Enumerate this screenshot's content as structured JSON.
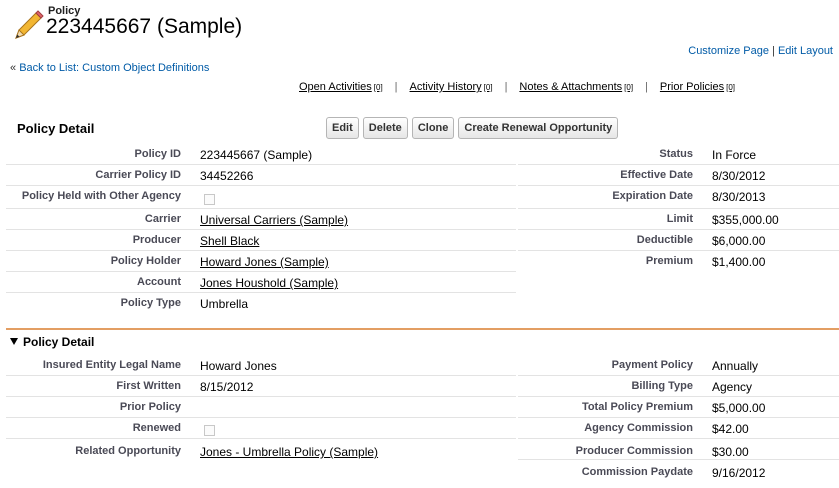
{
  "header": {
    "object_type": "Policy",
    "record_name": "223445667 (Sample)",
    "customize_page": "Customize Page",
    "link_separator": "|",
    "edit_layout": "Edit Layout",
    "back_prefix": "«",
    "back_link": "Back to List: Custom Object Definitions"
  },
  "related_links": [
    {
      "label": "Open Activities",
      "count": "[0]"
    },
    {
      "label": "Activity History",
      "count": "[0]"
    },
    {
      "label": "Notes & Attachments",
      "count": "[0]"
    },
    {
      "label": "Prior Policies",
      "count": "[0]"
    }
  ],
  "related_sep": "|",
  "detail": {
    "title": "Policy Detail",
    "buttons": {
      "edit": "Edit",
      "delete": "Delete",
      "clone": "Clone",
      "renewal": "Create Renewal Opportunity"
    },
    "left": [
      {
        "label": "Policy ID",
        "value": "223445667 (Sample)"
      },
      {
        "label": "Carrier Policy ID",
        "value": "34452266"
      },
      {
        "label": "Policy Held with Other Agency",
        "value": ""
      },
      {
        "label": "Carrier",
        "value": "Universal Carriers (Sample)"
      },
      {
        "label": "Producer",
        "value": "Shell Black"
      },
      {
        "label": "Policy Holder",
        "value": "Howard Jones (Sample)"
      },
      {
        "label": "Account",
        "value": "Jones Houshold (Sample)"
      },
      {
        "label": "Policy Type",
        "value": "Umbrella"
      }
    ],
    "right": [
      {
        "label": "Status",
        "value": "In Force"
      },
      {
        "label": "Effective Date",
        "value": "8/30/2012"
      },
      {
        "label": "Expiration Date",
        "value": "8/30/2013"
      },
      {
        "label": "Limit",
        "value": "$355,000.00"
      },
      {
        "label": "Deductible",
        "value": "$6,000.00"
      },
      {
        "label": "Premium",
        "value": "$1,400.00"
      }
    ]
  },
  "detail2": {
    "title": "Policy Detail",
    "left": [
      {
        "label": "Insured Entity Legal Name",
        "value": "Howard Jones"
      },
      {
        "label": "First Written",
        "value": "8/15/2012"
      },
      {
        "label": "Prior Policy",
        "value": ""
      },
      {
        "label": "Renewed",
        "value": ""
      },
      {
        "label": "Related Opportunity",
        "value": "Jones - Umbrella Policy (Sample)"
      }
    ],
    "right": [
      {
        "label": "Payment Policy",
        "value": "Annually"
      },
      {
        "label": "Billing Type",
        "value": "Agency"
      },
      {
        "label": "Total Policy Premium",
        "value": "$5,000.00"
      },
      {
        "label": "Agency Commission",
        "value": "$42.00"
      },
      {
        "label": "Producer Commission",
        "value": "$30.00"
      },
      {
        "label": "Commission Paydate",
        "value": "9/16/2012"
      }
    ]
  }
}
